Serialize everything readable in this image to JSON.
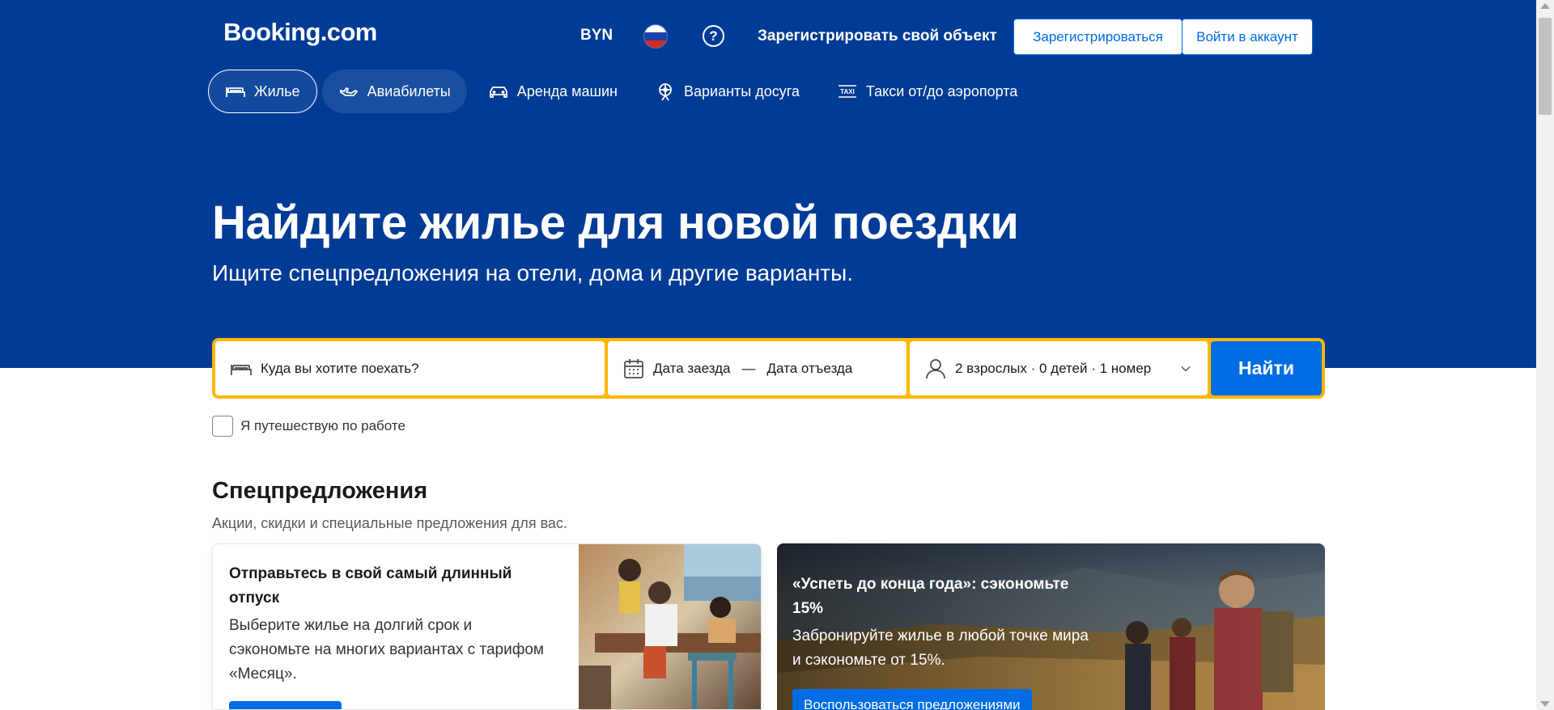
{
  "header": {
    "logo": "Booking.com",
    "currency": "BYN",
    "language_flag": "flag-russia-icon",
    "help_icon": "question-circle-icon",
    "register_property": "Зарегистрировать свой объект",
    "register_button": "Зарегистрироваться",
    "login_button": "Войти в аккаунт"
  },
  "tabs": [
    {
      "label": "Жилье",
      "icon": "bed-icon",
      "active": true
    },
    {
      "label": "Авиабилеты",
      "icon": "plane-icon",
      "active": false
    },
    {
      "label": "Аренда машин",
      "icon": "car-icon",
      "active": false
    },
    {
      "label": "Варианты досуга",
      "icon": "attractions-icon",
      "active": false
    },
    {
      "label": "Такси от/до аэропорта",
      "icon": "taxi-icon",
      "active": false
    }
  ],
  "hero": {
    "title": "Найдите жилье для новой поездки",
    "subtitle": "Ищите спецпредложения на отели, дома и другие варианты."
  },
  "search": {
    "destination_placeholder": "Куда вы хотите поехать?",
    "checkin": "Дата заезда",
    "separator": "—",
    "checkout": "Дата отъезда",
    "guests": "2 взрослых · 0 детей · 1 номер",
    "submit": "Найти"
  },
  "work_travel": {
    "label": "Я путешествую по работе",
    "checked": false
  },
  "offers": {
    "title": "Спецпредложения",
    "subtitle": "Акции, скидки и специальные предложения для вас.",
    "cards": [
      {
        "title": "Отправьтесь в свой самый длинный отпуск",
        "description": "Выберите жилье на долгий срок и сэкономьте на многих вариантах с тарифом «Месяц»."
      },
      {
        "title": "«Успеть до конца года»: сэкономьте 15%",
        "description": "Забронируйте жилье в любой точке мира и сэкономьте от 15%.",
        "button": "Воспользоваться предложениями"
      }
    ]
  },
  "colors": {
    "brand_blue": "#003b95",
    "action_blue": "#006ce4",
    "search_border": "#ffb700"
  }
}
